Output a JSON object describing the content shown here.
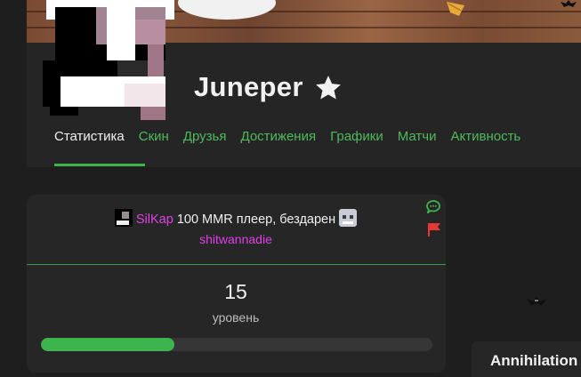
{
  "profile": {
    "username": "Juneper"
  },
  "tabs": [
    {
      "label": "Статистика",
      "active": true
    },
    {
      "label": "Скин"
    },
    {
      "label": "Друзья"
    },
    {
      "label": "Достижения"
    },
    {
      "label": "Графики"
    },
    {
      "label": "Матчи"
    },
    {
      "label": "Активность"
    }
  ],
  "status": {
    "name": "SilKap",
    "text": "100 MMR плеер, бездарен",
    "author": "shitwannadie"
  },
  "level": {
    "value": "15",
    "label": "уровень",
    "progress_fraction": 0.34
  },
  "side_panel": {
    "title": "Annihilation"
  },
  "icons": {
    "favorite": "star-icon",
    "comment": "chat-icon",
    "report": "flag-icon"
  },
  "colors": {
    "accent_green": "#3db54e",
    "tab_green": "#4fba5c",
    "status_pink": "#e040e8",
    "flag_red": "#e53935",
    "background": "#1e1e1e",
    "panel": "#252525"
  }
}
